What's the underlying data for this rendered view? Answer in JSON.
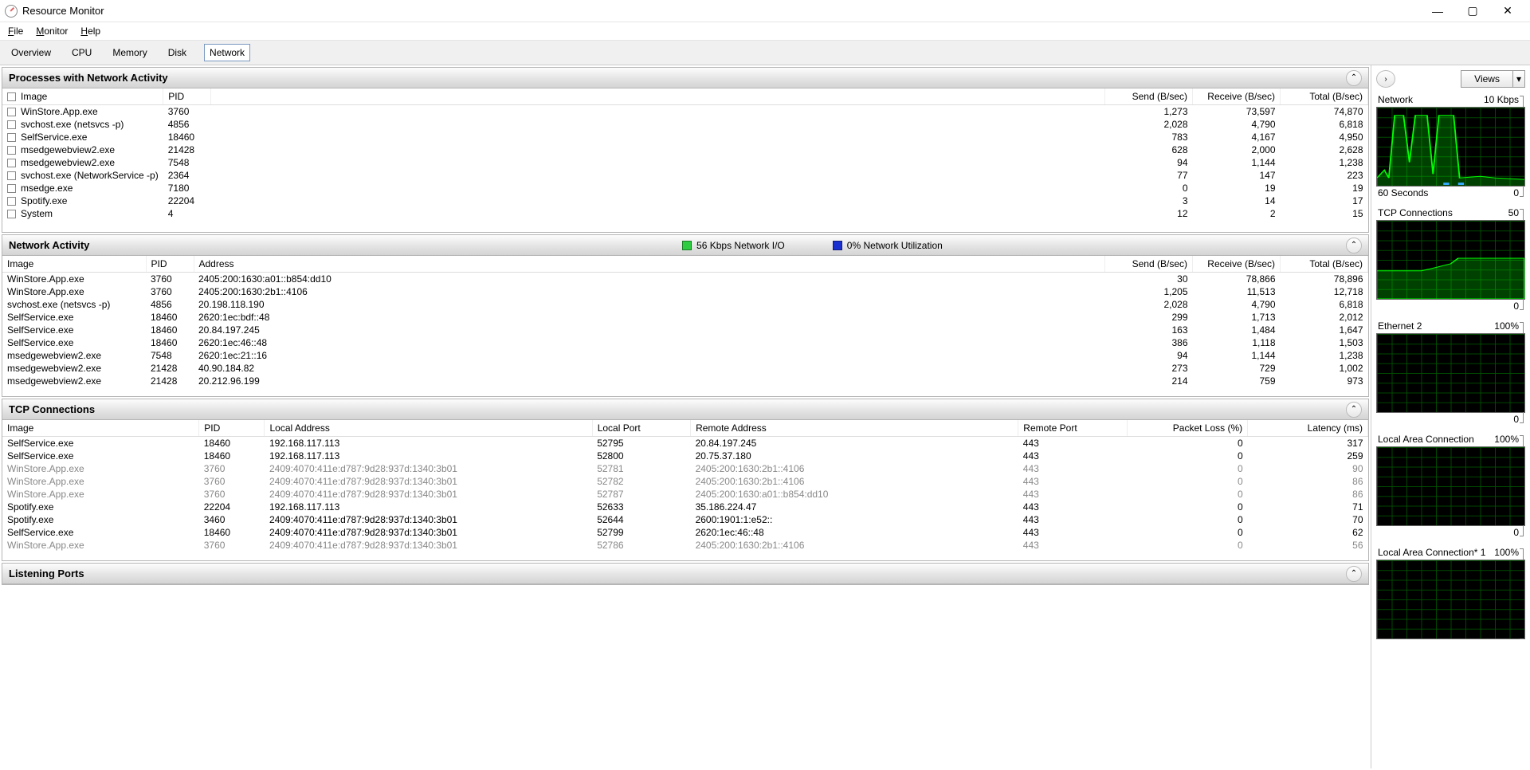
{
  "window": {
    "title": "Resource Monitor"
  },
  "menus": {
    "file": "File",
    "monitor": "Monitor",
    "help": "Help"
  },
  "tabs": {
    "overview": "Overview",
    "cpu": "CPU",
    "memory": "Memory",
    "disk": "Disk",
    "network": "Network"
  },
  "panels": {
    "processes": {
      "title": "Processes with Network Activity"
    },
    "activity": {
      "title": "Network Activity",
      "stat1": "56 Kbps Network I/O",
      "stat1_color": "#2ecc40",
      "stat2": "0% Network Utilization",
      "stat2_color": "#1a2fd0"
    },
    "tcp": {
      "title": "TCP Connections"
    },
    "ports": {
      "title": "Listening Ports"
    }
  },
  "processes_cols": {
    "image": "Image",
    "pid": "PID",
    "send": "Send (B/sec)",
    "recv": "Receive (B/sec)",
    "total": "Total (B/sec)"
  },
  "processes_rows": [
    {
      "image": "WinStore.App.exe",
      "pid": "3760",
      "send": "1,273",
      "recv": "73,597",
      "total": "74,870"
    },
    {
      "image": "svchost.exe (netsvcs -p)",
      "pid": "4856",
      "send": "2,028",
      "recv": "4,790",
      "total": "6,818"
    },
    {
      "image": "SelfService.exe",
      "pid": "18460",
      "send": "783",
      "recv": "4,167",
      "total": "4,950"
    },
    {
      "image": "msedgewebview2.exe",
      "pid": "21428",
      "send": "628",
      "recv": "2,000",
      "total": "2,628"
    },
    {
      "image": "msedgewebview2.exe",
      "pid": "7548",
      "send": "94",
      "recv": "1,144",
      "total": "1,238"
    },
    {
      "image": "svchost.exe (NetworkService -p)",
      "pid": "2364",
      "send": "77",
      "recv": "147",
      "total": "223"
    },
    {
      "image": "msedge.exe",
      "pid": "7180",
      "send": "0",
      "recv": "19",
      "total": "19"
    },
    {
      "image": "Spotify.exe",
      "pid": "22204",
      "send": "3",
      "recv": "14",
      "total": "17"
    },
    {
      "image": "System",
      "pid": "4",
      "send": "12",
      "recv": "2",
      "total": "15"
    }
  ],
  "activity_cols": {
    "image": "Image",
    "pid": "PID",
    "addr": "Address",
    "send": "Send (B/sec)",
    "recv": "Receive (B/sec)",
    "total": "Total (B/sec)"
  },
  "activity_rows": [
    {
      "image": "WinStore.App.exe",
      "pid": "3760",
      "addr": "2405:200:1630:a01::b854:dd10",
      "send": "30",
      "recv": "78,866",
      "total": "78,896"
    },
    {
      "image": "WinStore.App.exe",
      "pid": "3760",
      "addr": "2405:200:1630:2b1::4106",
      "send": "1,205",
      "recv": "11,513",
      "total": "12,718"
    },
    {
      "image": "svchost.exe (netsvcs -p)",
      "pid": "4856",
      "addr": "20.198.118.190",
      "send": "2,028",
      "recv": "4,790",
      "total": "6,818"
    },
    {
      "image": "SelfService.exe",
      "pid": "18460",
      "addr": "2620:1ec:bdf::48",
      "send": "299",
      "recv": "1,713",
      "total": "2,012"
    },
    {
      "image": "SelfService.exe",
      "pid": "18460",
      "addr": "20.84.197.245",
      "send": "163",
      "recv": "1,484",
      "total": "1,647"
    },
    {
      "image": "SelfService.exe",
      "pid": "18460",
      "addr": "2620:1ec:46::48",
      "send": "386",
      "recv": "1,118",
      "total": "1,503"
    },
    {
      "image": "msedgewebview2.exe",
      "pid": "7548",
      "addr": "2620:1ec:21::16",
      "send": "94",
      "recv": "1,144",
      "total": "1,238"
    },
    {
      "image": "msedgewebview2.exe",
      "pid": "21428",
      "addr": "40.90.184.82",
      "send": "273",
      "recv": "729",
      "total": "1,002"
    },
    {
      "image": "msedgewebview2.exe",
      "pid": "21428",
      "addr": "20.212.96.199",
      "send": "214",
      "recv": "759",
      "total": "973"
    }
  ],
  "tcp_cols": {
    "image": "Image",
    "pid": "PID",
    "laddr": "Local Address",
    "lport": "Local Port",
    "raddr": "Remote Address",
    "rport": "Remote Port",
    "loss": "Packet Loss (%)",
    "lat": "Latency (ms)"
  },
  "tcp_rows": [
    {
      "image": "SelfService.exe",
      "pid": "18460",
      "laddr": "192.168.117.113",
      "lport": "52795",
      "raddr": "20.84.197.245",
      "rport": "443",
      "loss": "0",
      "lat": "317",
      "gray": false
    },
    {
      "image": "SelfService.exe",
      "pid": "18460",
      "laddr": "192.168.117.113",
      "lport": "52800",
      "raddr": "20.75.37.180",
      "rport": "443",
      "loss": "0",
      "lat": "259",
      "gray": false
    },
    {
      "image": "WinStore.App.exe",
      "pid": "3760",
      "laddr": "2409:4070:411e:d787:9d28:937d:1340:3b01",
      "lport": "52781",
      "raddr": "2405:200:1630:2b1::4106",
      "rport": "443",
      "loss": "0",
      "lat": "90",
      "gray": true
    },
    {
      "image": "WinStore.App.exe",
      "pid": "3760",
      "laddr": "2409:4070:411e:d787:9d28:937d:1340:3b01",
      "lport": "52782",
      "raddr": "2405:200:1630:2b1::4106",
      "rport": "443",
      "loss": "0",
      "lat": "86",
      "gray": true
    },
    {
      "image": "WinStore.App.exe",
      "pid": "3760",
      "laddr": "2409:4070:411e:d787:9d28:937d:1340:3b01",
      "lport": "52787",
      "raddr": "2405:200:1630:a01::b854:dd10",
      "rport": "443",
      "loss": "0",
      "lat": "86",
      "gray": true
    },
    {
      "image": "Spotify.exe",
      "pid": "22204",
      "laddr": "192.168.117.113",
      "lport": "52633",
      "raddr": "35.186.224.47",
      "rport": "443",
      "loss": "0",
      "lat": "71",
      "gray": false
    },
    {
      "image": "Spotify.exe",
      "pid": "3460",
      "laddr": "2409:4070:411e:d787:9d28:937d:1340:3b01",
      "lport": "52644",
      "raddr": "2600:1901:1:e52::",
      "rport": "443",
      "loss": "0",
      "lat": "70",
      "gray": false
    },
    {
      "image": "SelfService.exe",
      "pid": "18460",
      "laddr": "2409:4070:411e:d787:9d28:937d:1340:3b01",
      "lport": "52799",
      "raddr": "2620:1ec:46::48",
      "rport": "443",
      "loss": "0",
      "lat": "62",
      "gray": false
    },
    {
      "image": "WinStore.App.exe",
      "pid": "3760",
      "laddr": "2409:4070:411e:d787:9d28:937d:1340:3b01",
      "lport": "52786",
      "raddr": "2405:200:1630:2b1::4106",
      "rport": "443",
      "loss": "0",
      "lat": "56",
      "gray": true
    }
  ],
  "side": {
    "views": "Views",
    "charts": [
      {
        "title": "Network",
        "right": "10 Kbps",
        "foot_left": "60 Seconds",
        "foot_right": "0",
        "kind": "net"
      },
      {
        "title": "TCP Connections",
        "right": "50",
        "foot_left": "",
        "foot_right": "0",
        "kind": "tcp"
      },
      {
        "title": "Ethernet 2",
        "right": "100%",
        "foot_left": "",
        "foot_right": "0",
        "kind": "flat"
      },
      {
        "title": "Local Area Connection",
        "right": "100%",
        "foot_left": "",
        "foot_right": "0",
        "kind": "flat"
      },
      {
        "title": "Local Area Connection* 1",
        "right": "100%",
        "foot_left": "",
        "foot_right": "",
        "kind": "flat"
      }
    ]
  },
  "chart_data": [
    {
      "type": "line",
      "title": "Network",
      "ylabel": "Kbps",
      "ylim": [
        0,
        10
      ],
      "xlabel": "60 Seconds",
      "x": [
        0,
        5,
        10,
        15,
        20,
        25,
        30,
        35,
        40,
        45,
        50,
        55,
        60
      ],
      "series": [
        {
          "name": "I/O",
          "values": [
            1,
            2,
            1,
            10,
            10,
            3,
            10,
            10,
            2,
            10,
            10,
            1,
            1
          ]
        }
      ]
    },
    {
      "type": "line",
      "title": "TCP Connections",
      "ylim": [
        0,
        50
      ],
      "x": [
        0,
        10,
        20,
        30,
        40,
        50,
        60
      ],
      "series": [
        {
          "name": "Connections",
          "values": [
            18,
            18,
            18,
            20,
            25,
            25,
            25
          ]
        }
      ]
    },
    {
      "type": "line",
      "title": "Ethernet 2",
      "ylim": [
        0,
        100
      ],
      "x": [
        0,
        60
      ],
      "series": [
        {
          "name": "Util %",
          "values": [
            0,
            0
          ]
        }
      ]
    },
    {
      "type": "line",
      "title": "Local Area Connection",
      "ylim": [
        0,
        100
      ],
      "x": [
        0,
        60
      ],
      "series": [
        {
          "name": "Util %",
          "values": [
            0,
            0
          ]
        }
      ]
    },
    {
      "type": "line",
      "title": "Local Area Connection* 1",
      "ylim": [
        0,
        100
      ],
      "x": [
        0,
        60
      ],
      "series": [
        {
          "name": "Util %",
          "values": [
            0,
            0
          ]
        }
      ]
    }
  ]
}
